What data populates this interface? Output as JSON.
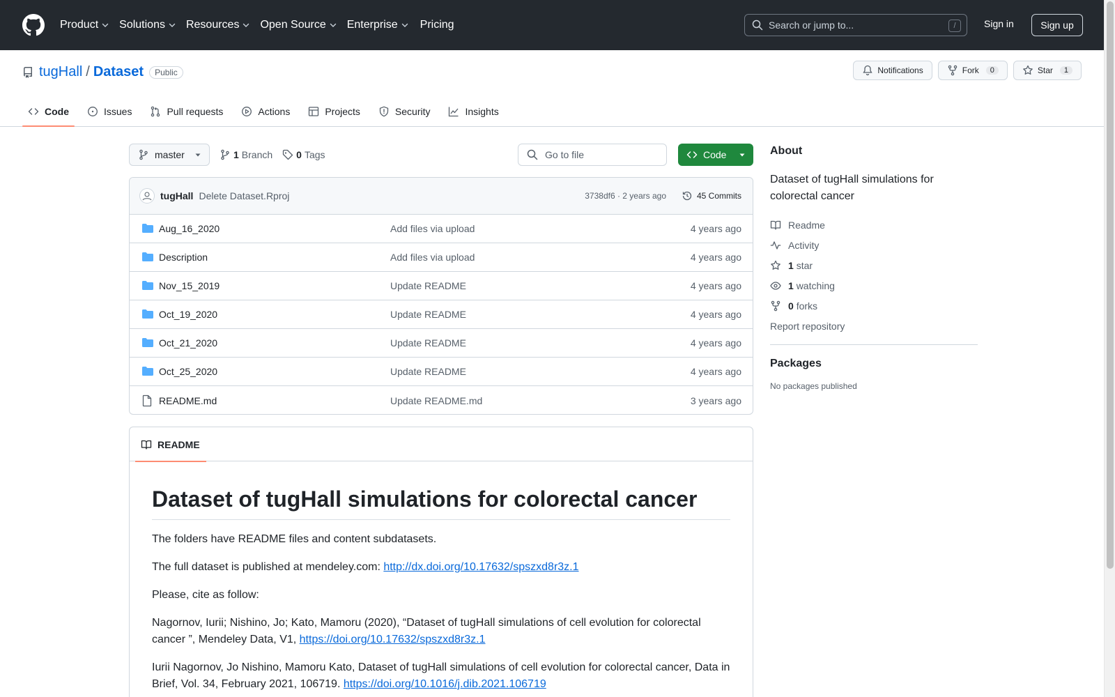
{
  "header": {
    "nav": [
      {
        "label": "Product",
        "has_dropdown": true
      },
      {
        "label": "Solutions",
        "has_dropdown": true
      },
      {
        "label": "Resources",
        "has_dropdown": true
      },
      {
        "label": "Open Source",
        "has_dropdown": true
      },
      {
        "label": "Enterprise",
        "has_dropdown": true
      },
      {
        "label": "Pricing",
        "has_dropdown": false
      }
    ],
    "search_placeholder": "Search or jump to...",
    "search_shortcut": "/",
    "sign_in": "Sign in",
    "sign_up": "Sign up"
  },
  "repo": {
    "owner": "tugHall",
    "separator": "/",
    "name": "Dataset",
    "visibility": "Public",
    "notifications_label": "Notifications",
    "fork_label": "Fork",
    "fork_count": "0",
    "star_label": "Star",
    "star_count": "1",
    "tabs": [
      {
        "label": "Code",
        "icon": "code-icon",
        "active": true
      },
      {
        "label": "Issues",
        "icon": "issue-icon",
        "active": false
      },
      {
        "label": "Pull requests",
        "icon": "pull-request-icon",
        "active": false
      },
      {
        "label": "Actions",
        "icon": "play-icon",
        "active": false
      },
      {
        "label": "Projects",
        "icon": "table-icon",
        "active": false
      },
      {
        "label": "Security",
        "icon": "shield-icon",
        "active": false
      },
      {
        "label": "Insights",
        "icon": "graph-icon",
        "active": false
      }
    ]
  },
  "toolbar": {
    "branch": "master",
    "branch_count": "1",
    "branch_label": "Branch",
    "tag_count": "0",
    "tag_label": "Tags",
    "goto_placeholder": "Go to file",
    "code_button": "Code"
  },
  "commit": {
    "author": "tugHall",
    "message": "Delete Dataset.Rproj",
    "sha_time": "3738df6 · 2 years ago",
    "commits_label": "45 Commits"
  },
  "files": [
    {
      "type": "folder",
      "name": "Aug_16_2020",
      "message": "Add files via upload",
      "date": "4 years ago"
    },
    {
      "type": "folder",
      "name": "Description",
      "message": "Add files via upload",
      "date": "4 years ago"
    },
    {
      "type": "folder",
      "name": "Nov_15_2019",
      "message": "Update README",
      "date": "4 years ago"
    },
    {
      "type": "folder",
      "name": "Oct_19_2020",
      "message": "Update README",
      "date": "4 years ago"
    },
    {
      "type": "folder",
      "name": "Oct_21_2020",
      "message": "Update README",
      "date": "4 years ago"
    },
    {
      "type": "folder",
      "name": "Oct_25_2020",
      "message": "Update README",
      "date": "4 years ago"
    },
    {
      "type": "file",
      "name": "README.md",
      "message": "Update README.md",
      "date": "3 years ago"
    }
  ],
  "readme": {
    "tab_label": "README",
    "title": "Dataset of tugHall simulations for colorectal cancer",
    "p1": "The folders have README files and content subdatasets.",
    "p2_text": "The full dataset is published at mendeley.com: ",
    "p2_link": "http://dx.doi.org/10.17632/spszxd8r3z.1",
    "p3": "Please, cite as follow:",
    "p4_text": "Nagornov, Iurii; Nishino, Jo; Kato, Mamoru (2020), “Dataset of tugHall simulations of cell evolution for colorectal cancer ”, Mendeley Data, V1, ",
    "p4_link": "https://doi.org/10.17632/spszxd8r3z.1",
    "p5_text": "Iurii Nagornov, Jo Nishino, Mamoru Kato, Dataset of tugHall simulations of cell evolution for colorectal cancer, Data in Brief, Vol. 34, February 2021, 106719. ",
    "p5_link": "https://doi.org/10.1016/j.dib.2021.106719"
  },
  "about": {
    "heading": "About",
    "description": "Dataset of tugHall simulations for colorectal cancer",
    "readme_label": "Readme",
    "activity_label": "Activity",
    "stars_count": "1",
    "stars_label": "star",
    "watching_count": "1",
    "watching_label": "watching",
    "forks_count": "0",
    "forks_label": "forks",
    "report": "Report repository",
    "packages_heading": "Packages",
    "no_packages": "No packages published"
  },
  "colors": {
    "header_bg": "#24292f",
    "link": "#0969da",
    "code_button": "#1f883d",
    "folder": "#54aeff",
    "active_tab_underline": "#fd8c73"
  }
}
